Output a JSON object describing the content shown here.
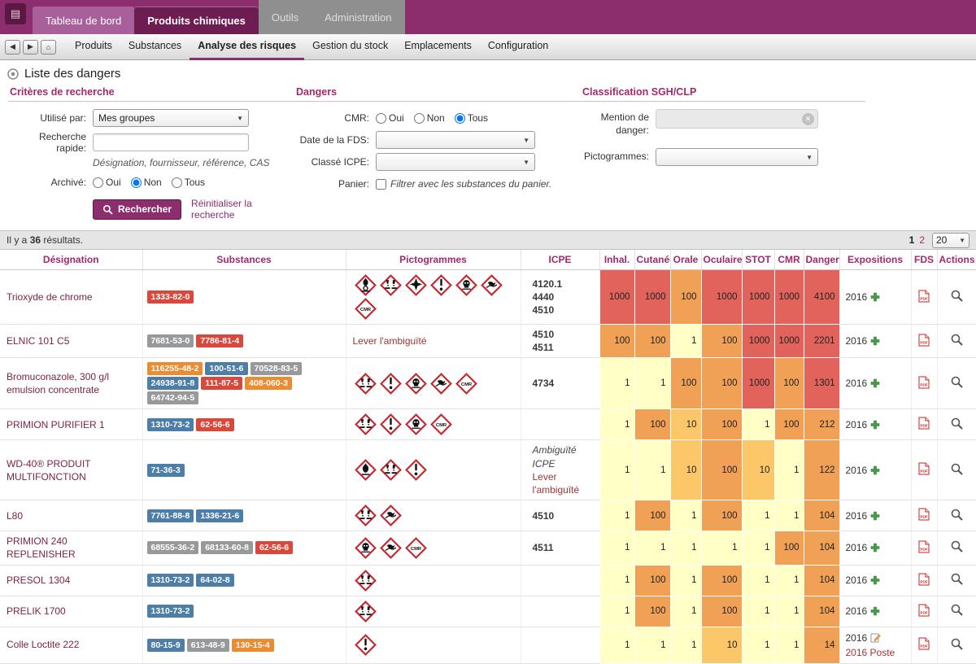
{
  "colors": {
    "primary": "#8c2d6e",
    "primary_dark": "#6e1d52",
    "primary_light": "#a7609a",
    "accent_text": "#a4286b",
    "name_text": "#7d2248",
    "link_red": "#9c3434",
    "tab_gray": "#8f8f8f"
  },
  "topnav": {
    "tabs": [
      {
        "label": "Tableau de bord",
        "state": "normal"
      },
      {
        "label": "Produits chimiques",
        "state": "active"
      },
      {
        "label": "Outils",
        "state": "gray"
      },
      {
        "label": "Administration",
        "state": "gray"
      }
    ]
  },
  "navbar": {
    "items": [
      {
        "label": "Produits",
        "active": false
      },
      {
        "label": "Substances",
        "active": false
      },
      {
        "label": "Analyse des risques",
        "active": true
      },
      {
        "label": "Gestion du stock",
        "active": false
      },
      {
        "label": "Emplacements",
        "active": false
      },
      {
        "label": "Configuration",
        "active": false
      }
    ]
  },
  "page": {
    "title": "Liste des dangers"
  },
  "search": {
    "criteria_title": "Critères de recherche",
    "dangers_title": "Dangers",
    "classification_title": "Classification SGH/CLP",
    "used_by_label": "Utilisé par:",
    "used_by_value": "Mes groupes",
    "quick_label": "Recherche rapide:",
    "quick_hint": "Désignation, fournisseur, référence, CAS",
    "archived_label": "Archivé:",
    "archived_options": [
      "Oui",
      "Non",
      "Tous"
    ],
    "archived_selected": "Non",
    "cmr_label": "CMR:",
    "cmr_options": [
      "Oui",
      "Non",
      "Tous"
    ],
    "cmr_selected": "Tous",
    "fds_date_label": "Date de la FDS:",
    "icpe_class_label": "Classé ICPE:",
    "basket_label": "Panier:",
    "basket_text": "Filtrer avec les substances du panier.",
    "mention_label_line1": "Mention de",
    "mention_label_line2": "danger:",
    "picto_label": "Pictogrammes:",
    "search_button": "Rechercher",
    "reset_link": "Réinitialiser la recherche"
  },
  "results": {
    "prefix": "Il y a ",
    "count": "36",
    "suffix": " résultats.",
    "pages": [
      {
        "label": "1",
        "current": true
      },
      {
        "label": "2",
        "current": false
      }
    ],
    "page_size": "20"
  },
  "table": {
    "headers": [
      "Désignation",
      "Substances",
      "Pictogrammes",
      "ICPE",
      "Inhal.",
      "Cutanée",
      "Orale",
      "Oculaire",
      "STOT",
      "CMR",
      "Danger",
      "Expositions",
      "FDS",
      "Actions"
    ],
    "badge_colors": {
      "red": "#d9483b",
      "orange": "#ec8b2f",
      "blue": "#4c7ea8",
      "gray": "#97999b"
    },
    "cell_colors": {
      "pale": "#ffffc6",
      "mid": "#fbc768",
      "orange": "#f0a155",
      "red": "#e2635c"
    },
    "rows": [
      {
        "designation": "Trioxyde de chrome",
        "substances": [
          {
            "cas": "1333-82-0",
            "color": "red"
          }
        ],
        "pictos": [
          "oxidizer",
          "corrosion",
          "health",
          "exclam",
          "skull",
          "environment",
          "cmr"
        ],
        "icpe": [
          "4120.1",
          "4440",
          "4510"
        ],
        "values": {
          "inhal": 1000,
          "cutanee": 1000,
          "orale": 100,
          "oculaire": 1000,
          "stot": 1000,
          "cmr": 1000,
          "danger": 4100
        },
        "expositions": [
          {
            "text": "2016",
            "icon": "plus"
          }
        ]
      },
      {
        "designation": "ELNIC 101 C5",
        "substances": [
          {
            "cas": "7681-53-0",
            "color": "gray"
          },
          {
            "cas": "7786-81-4",
            "color": "red"
          }
        ],
        "picto_note": "Lever l'ambiguïté",
        "pictos": [],
        "icpe": [
          "4510",
          "4511"
        ],
        "values": {
          "inhal": 100,
          "cutanee": 100,
          "orale": 1,
          "oculaire": 100,
          "stot": 1000,
          "cmr": 1000,
          "danger": 2201
        },
        "expositions": [
          {
            "text": "2016",
            "icon": "plus"
          }
        ]
      },
      {
        "designation": "Bromuconazole, 300 g/l emulsion concentrate",
        "substances": [
          {
            "cas": "116255-48-2",
            "color": "orange"
          },
          {
            "cas": "100-51-6",
            "color": "blue"
          },
          {
            "cas": "70528-83-5",
            "color": "gray"
          },
          {
            "cas": "24938-91-8",
            "color": "blue"
          },
          {
            "cas": "111-87-5",
            "color": "red"
          },
          {
            "cas": "408-060-3",
            "color": "orange"
          },
          {
            "cas": "64742-94-5",
            "color": "gray"
          }
        ],
        "pictos": [
          "corrosion",
          "exclam",
          "skull",
          "environment",
          "cmr"
        ],
        "icpe": [
          "4734"
        ],
        "values": {
          "inhal": 1,
          "cutanee": 1,
          "orale": 100,
          "oculaire": 100,
          "stot": 1000,
          "cmr": 100,
          "danger": 1301
        },
        "expositions": [
          {
            "text": "2016",
            "icon": "plus"
          }
        ]
      },
      {
        "designation": "PRIMION PURIFIER 1",
        "substances": [
          {
            "cas": "1310-73-2",
            "color": "blue"
          },
          {
            "cas": "62-56-6",
            "color": "red"
          }
        ],
        "pictos": [
          "corrosion",
          "exclam",
          "skull",
          "cmr"
        ],
        "icpe": [],
        "values": {
          "inhal": 1,
          "cutanee": 100,
          "orale": 10,
          "oculaire": 100,
          "stot": 1,
          "cmr": 100,
          "danger": 212
        },
        "expositions": [
          {
            "text": "2016",
            "icon": "plus"
          }
        ]
      },
      {
        "designation": "WD-40® PRODUIT MULTIFONCTION",
        "substances": [
          {
            "cas": "71-36-3",
            "color": "blue"
          }
        ],
        "pictos": [
          "flame",
          "corrosion",
          "exclam"
        ],
        "icpe": [],
        "icpe_italic": "Ambiguïté ICPE",
        "icpe_link": "Lever l'ambiguïté",
        "values": {
          "inhal": 1,
          "cutanee": 1,
          "orale": 10,
          "oculaire": 100,
          "stot": 10,
          "cmr": 1,
          "danger": 122
        },
        "expositions": [
          {
            "text": "2016",
            "icon": "plus"
          }
        ]
      },
      {
        "designation": "L80",
        "substances": [
          {
            "cas": "7761-88-8",
            "color": "blue"
          },
          {
            "cas": "1336-21-6",
            "color": "blue"
          }
        ],
        "pictos": [
          "corrosion",
          "environment"
        ],
        "icpe": [
          "4510"
        ],
        "values": {
          "inhal": 1,
          "cutanee": 100,
          "orale": 1,
          "oculaire": 100,
          "stot": 1,
          "cmr": 1,
          "danger": 104
        },
        "expositions": [
          {
            "text": "2016",
            "icon": "plus"
          }
        ]
      },
      {
        "designation": "PRIMION 240 REPLENISHER",
        "substances": [
          {
            "cas": "68555-36-2",
            "color": "gray"
          },
          {
            "cas": "68133-60-8",
            "color": "gray"
          },
          {
            "cas": "62-56-6",
            "color": "red"
          }
        ],
        "pictos": [
          "skull",
          "environment",
          "cmr"
        ],
        "icpe": [
          "4511"
        ],
        "values": {
          "inhal": 1,
          "cutanee": 1,
          "orale": 1,
          "oculaire": 1,
          "stot": 1,
          "cmr": 100,
          "danger": 104
        },
        "expositions": [
          {
            "text": "2016",
            "icon": "plus"
          }
        ]
      },
      {
        "designation": "PRESOL 1304",
        "substances": [
          {
            "cas": "1310-73-2",
            "color": "blue"
          },
          {
            "cas": "64-02-8",
            "color": "blue"
          }
        ],
        "pictos": [
          "corrosion"
        ],
        "icpe": [],
        "values": {
          "inhal": 1,
          "cutanee": 100,
          "orale": 1,
          "oculaire": 100,
          "stot": 1,
          "cmr": 1,
          "danger": 104
        },
        "expositions": [
          {
            "text": "2016",
            "icon": "plus"
          }
        ]
      },
      {
        "designation": "PRELIK 1700",
        "substances": [
          {
            "cas": "1310-73-2",
            "color": "blue"
          }
        ],
        "pictos": [
          "corrosion"
        ],
        "icpe": [],
        "values": {
          "inhal": 1,
          "cutanee": 100,
          "orale": 1,
          "oculaire": 100,
          "stot": 1,
          "cmr": 1,
          "danger": 104
        },
        "expositions": [
          {
            "text": "2016",
            "icon": "plus"
          }
        ]
      },
      {
        "designation": "Colle Loctite 222",
        "substances": [
          {
            "cas": "80-15-9",
            "color": "blue"
          },
          {
            "cas": "613-48-9",
            "color": "gray"
          },
          {
            "cas": "130-15-4",
            "color": "orange"
          }
        ],
        "pictos": [
          "exclam"
        ],
        "icpe": [],
        "values": {
          "inhal": 1,
          "cutanee": 1,
          "orale": 1,
          "oculaire": 10,
          "stot": 1,
          "cmr": 1,
          "danger": 14
        },
        "expositions": [
          {
            "text": "2016",
            "icon": "edit"
          },
          {
            "text": "2016 Poste",
            "icon": "none",
            "red": true
          }
        ]
      }
    ]
  }
}
